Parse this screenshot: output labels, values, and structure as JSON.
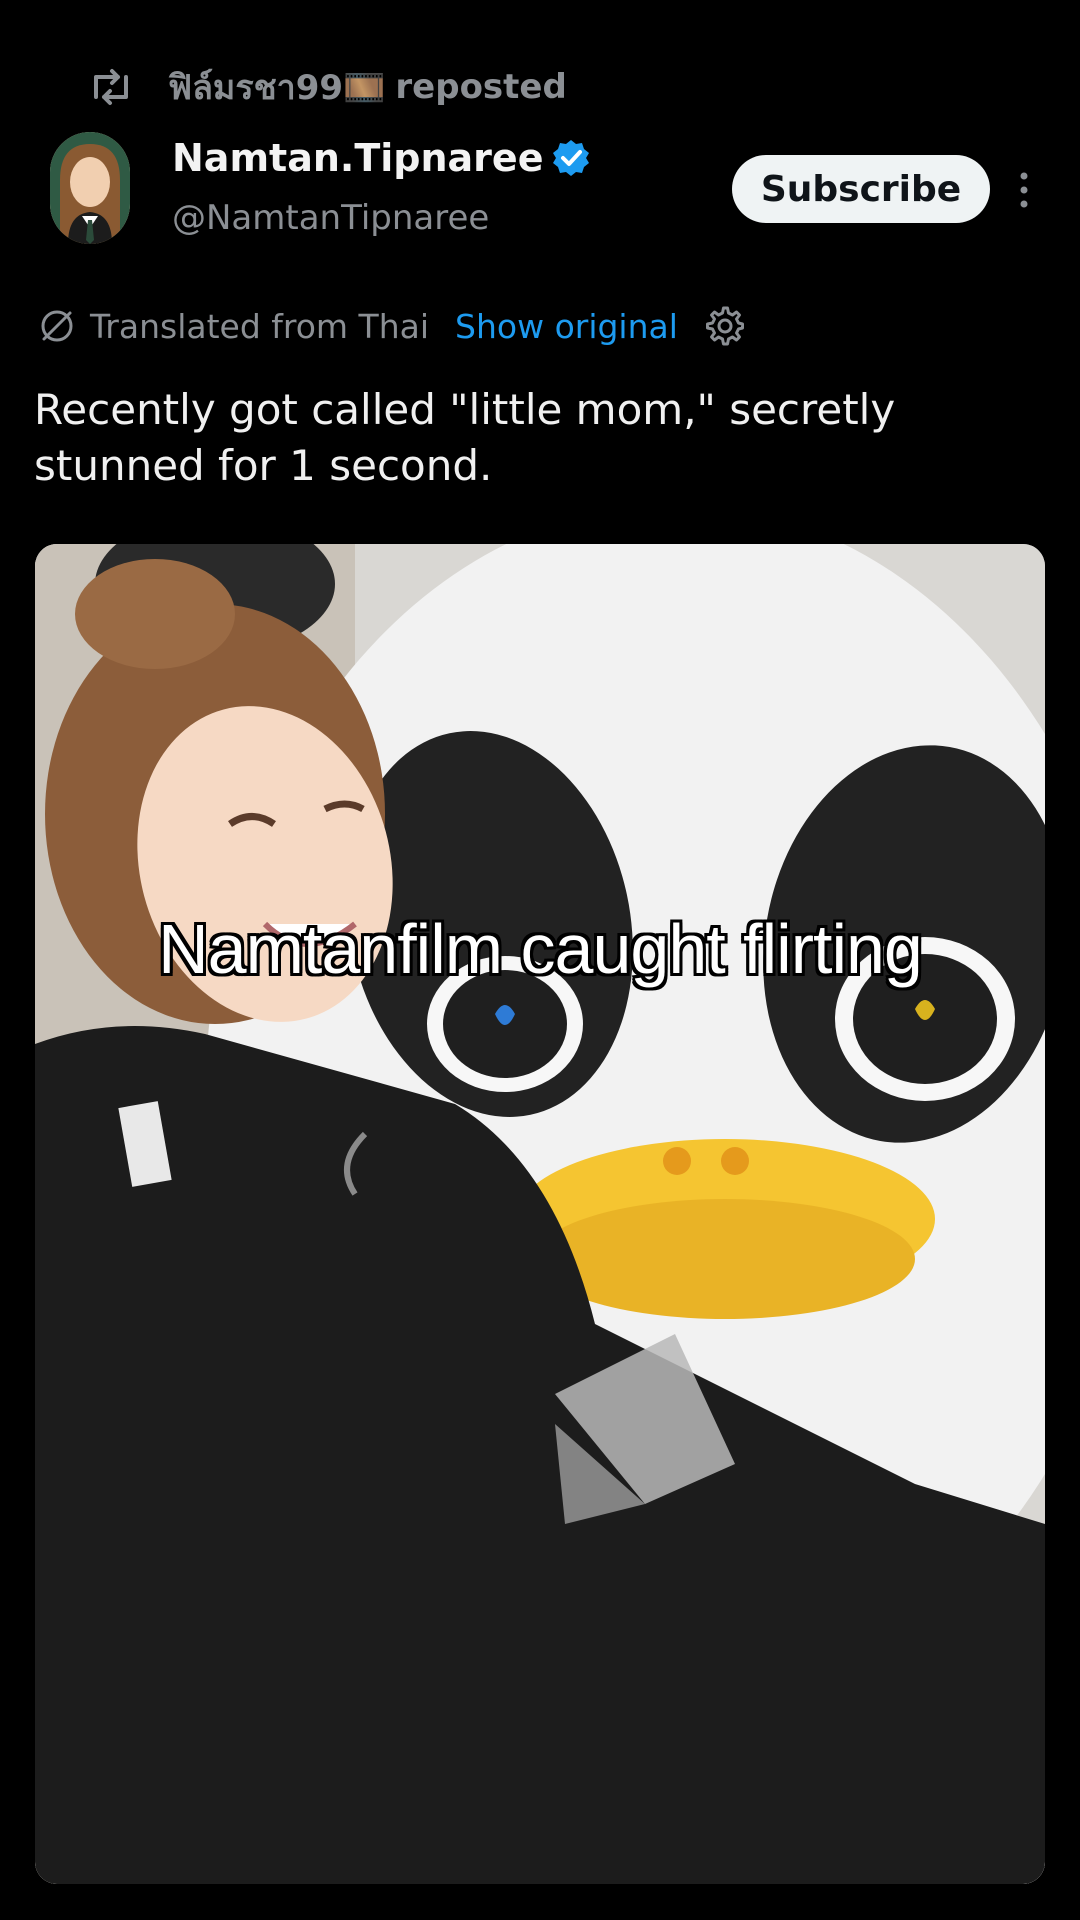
{
  "repost": {
    "icon": "repost-icon",
    "user": "ฟิล์มรชา99🎞️",
    "label": "reposted"
  },
  "author": {
    "display_name": "Namtan.Tipnaree",
    "handle": "@NamtanTipnaree",
    "verified": true,
    "verified_color": "#1d9bf0"
  },
  "actions": {
    "subscribe_label": "Subscribe",
    "more_icon": "more-vertical-icon"
  },
  "translation": {
    "label": "Translated from Thai",
    "show_original": "Show original",
    "settings_icon": "gear-icon"
  },
  "post": {
    "text": "Recently got called \"little mom,\" secretly\nstunned for 1 second."
  },
  "media": {
    "caption": "Namtanfilm caught flirting"
  },
  "colors": {
    "background": "#000000",
    "link": "#1d9bf0",
    "muted": "#8b8f94",
    "subscribe_bg": "#eff3f4"
  }
}
